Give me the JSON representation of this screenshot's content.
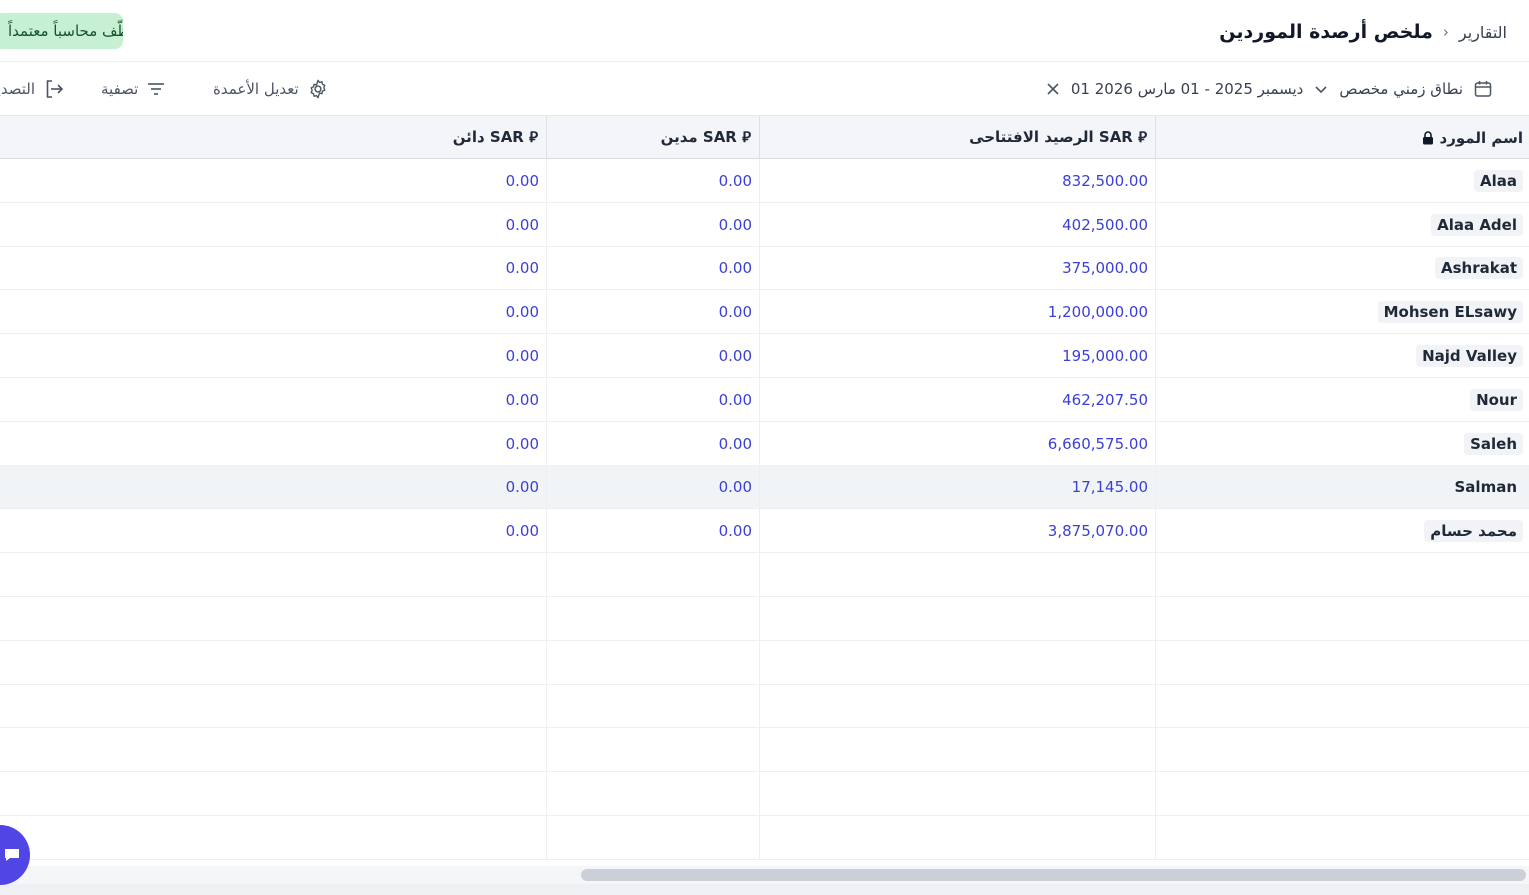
{
  "header": {
    "breadcrumb_parent": "التقارير",
    "breadcrumb_separator": "›",
    "title": "ملخص أرصدة الموردين",
    "hire_button": "وظّف محاسباً معتمداً"
  },
  "toolbar": {
    "date_range_label": "نطاق زمني مخصص",
    "date_range_value": "01 ديسمبر 2025 - 01 مارس 2026",
    "edit_columns_label": "تعديل الأعمدة",
    "filter_label": "تصفية",
    "export_label": "التصدير"
  },
  "table": {
    "columns": {
      "supplier_name": "اسم المورد",
      "opening_balance": "الرصيد الافتتاحى SAR ⃁",
      "debit": "مدين SAR ⃁",
      "credit": "دائن SAR ⃁"
    },
    "rows": [
      {
        "name": "Alaa",
        "opening": "832,500.00",
        "debit": "0.00",
        "credit": "0.00"
      },
      {
        "name": "Alaa Adel",
        "opening": "402,500.00",
        "debit": "0.00",
        "credit": "0.00"
      },
      {
        "name": "Ashrakat",
        "opening": "375,000.00",
        "debit": "0.00",
        "credit": "0.00"
      },
      {
        "name": "Mohsen ELsawy",
        "opening": "1,200,000.00",
        "debit": "0.00",
        "credit": "0.00"
      },
      {
        "name": "Najd Valley",
        "opening": "195,000.00",
        "debit": "0.00",
        "credit": "0.00"
      },
      {
        "name": "Nour",
        "opening": "462,207.50",
        "debit": "0.00",
        "credit": "0.00"
      },
      {
        "name": "Saleh",
        "opening": "6,660,575.00",
        "debit": "0.00",
        "credit": "0.00"
      },
      {
        "name": "Salman",
        "opening": "17,145.00",
        "debit": "0.00",
        "credit": "0.00"
      },
      {
        "name": "محمد حسام",
        "opening": "3,875,070.00",
        "debit": "0.00",
        "credit": "0.00"
      }
    ]
  },
  "colors": {
    "accent": "#4f46e5",
    "number": "#3b3fd6",
    "hire_bg": "#c7f0d3"
  }
}
